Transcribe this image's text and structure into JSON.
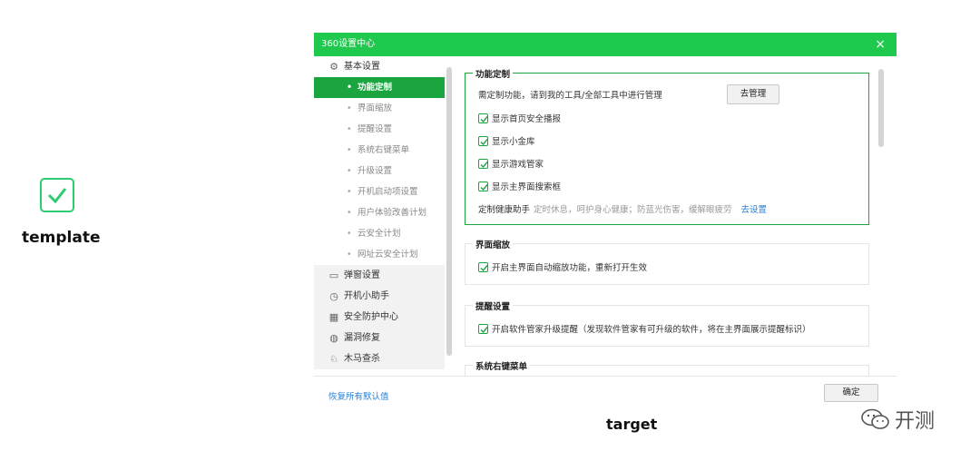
{
  "template_label": "template",
  "target_label": "target",
  "watermark": "开测",
  "colors": {
    "accent": "#1fc94e",
    "active": "#1aa53e",
    "link": "#2a7fd4"
  },
  "window": {
    "title": "360设置中心",
    "close": "×",
    "sidebar": {
      "group_basic": {
        "icon": "gear-icon",
        "label": "基本设置"
      },
      "items": [
        "功能定制",
        "界面缩放",
        "提醒设置",
        "系统右键菜单",
        "升级设置",
        "开机启动项设置",
        "用户体验改善计划",
        "云安全计划",
        "网址云安全计划"
      ],
      "active_index": 0,
      "groups": [
        {
          "icon": "window-icon",
          "label": "弹窗设置"
        },
        {
          "icon": "stopwatch-icon",
          "label": "开机小助手"
        },
        {
          "icon": "shield-grid-icon",
          "label": "安全防护中心"
        },
        {
          "icon": "patch-icon",
          "label": "漏洞修复"
        },
        {
          "icon": "horse-icon",
          "label": "木马查杀"
        }
      ]
    },
    "content": {
      "feature": {
        "title": "功能定制",
        "desc": "需定制功能，请到我的工具/全部工具中进行管理",
        "manage_button": "去管理",
        "options": [
          "显示首页安全播报",
          "显示小金库",
          "显示游戏管家",
          "显示主界面搜索框"
        ],
        "health_label": "定制健康助手",
        "health_desc": "定时休息，呵护身心健康；防蓝光伤害，缓解眼疲劳",
        "health_link": "去设置"
      },
      "zoom": {
        "title": "界面缩放",
        "option": "开启主界面自动缩放功能，重新打开生效"
      },
      "remind": {
        "title": "提醒设置",
        "option": "开启软件管家升级提醒（发现软件管家有可升级的软件，将在主界面展示提醒标识）"
      },
      "context": {
        "title": "系统右键菜单"
      }
    },
    "footer": {
      "restore": "恢复所有默认值",
      "confirm": "确定"
    }
  }
}
